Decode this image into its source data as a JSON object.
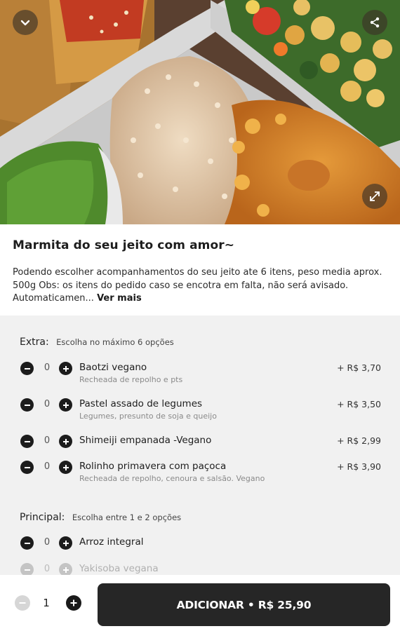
{
  "product": {
    "title": "Marmita do seu jeito com amor~",
    "description": "Podendo escolher acompanhamentos do seu jeito ate 6 itens, peso media aprox. 500g Obs: os itens do pedido caso se encotra em falta, não será avisado. Automaticamen...",
    "more_label": "Ver mais"
  },
  "groups": {
    "extra": {
      "title": "Extra:",
      "hint": "Escolha no máximo 6 opções",
      "items": [
        {
          "qty": "0",
          "name": "Baotzi vegano",
          "sub": "Recheada de repolho e pts",
          "price": "+ R$ 3,70"
        },
        {
          "qty": "0",
          "name": "Pastel assado de legumes",
          "sub": "Legumes, presunto de soja e queijo",
          "price": "+ R$ 3,50"
        },
        {
          "qty": "0",
          "name": "Shimeiji empanada -Vegano",
          "sub": "",
          "price": "+ R$ 2,99"
        },
        {
          "qty": "0",
          "name": "Rolinho primavera com paçoca",
          "sub": "Recheada de repolho, cenoura e salsão. Vegano",
          "price": "+ R$ 3,90"
        }
      ]
    },
    "principal": {
      "title": "Principal:",
      "hint": "Escolha entre 1 e 2 opções",
      "items": [
        {
          "qty": "0",
          "name": "Arroz integral"
        },
        {
          "qty": "0",
          "name": "Yakisoba vegana"
        }
      ]
    }
  },
  "bottom": {
    "qty": "1",
    "add_label": "ADICIONAR • R$ 25,90"
  },
  "icons": {
    "back": "chevron-down-icon",
    "share": "share-icon",
    "expand": "expand-icon"
  },
  "colors": {
    "button_dark": "#262626",
    "options_bg": "#f1f1f1"
  }
}
